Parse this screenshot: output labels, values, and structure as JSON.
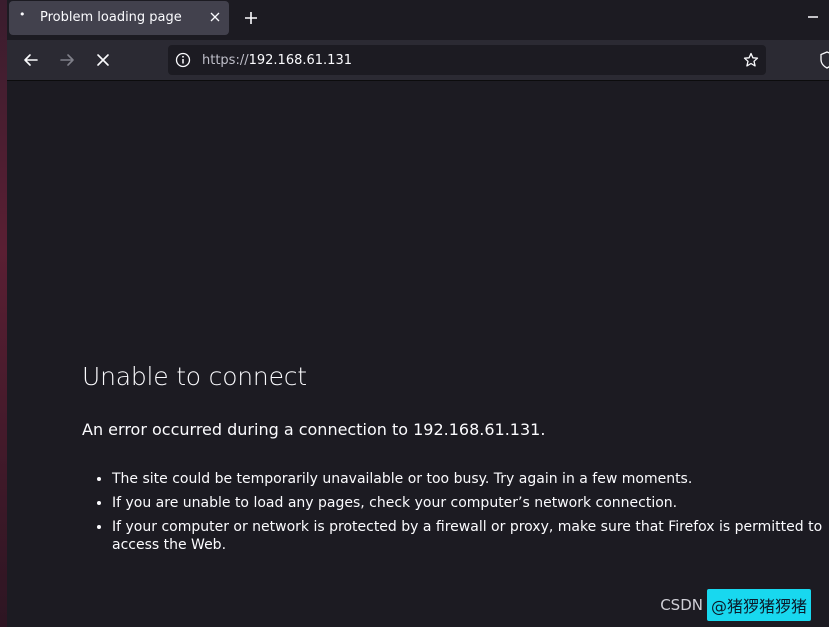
{
  "tab": {
    "title": "Problem loading page",
    "dot": "•"
  },
  "urlbar": {
    "scheme": "https://",
    "host": "192.168.61.131"
  },
  "error": {
    "title": "Unable to connect",
    "description": "An error occurred during a connection to 192.168.61.131.",
    "items": [
      "The site could be temporarily unavailable or too busy. Try again in a few moments.",
      "If you are unable to load any pages, check your computer’s network connection.",
      "If your computer or network is protected by a firewall or proxy, make sure that Firefox is permitted to access the Web."
    ]
  },
  "watermark": {
    "site": "CSDN",
    "user": "@猪猡猪猡猪"
  },
  "icons": {
    "tab_close": "close-icon",
    "new_tab": "plus-icon",
    "minimize": "minimize-icon",
    "back": "arrow-left-icon",
    "forward": "arrow-right-icon",
    "stop": "stop-icon",
    "info": "info-icon",
    "bookmark": "star-icon",
    "shield": "shield-icon"
  },
  "colors": {
    "page_bg": "#1c1b22",
    "toolbar_bg": "#2b2a33",
    "tab_bg": "#42414d",
    "text": "#fbfbfe",
    "watermark_bg": "#18d8ef"
  }
}
